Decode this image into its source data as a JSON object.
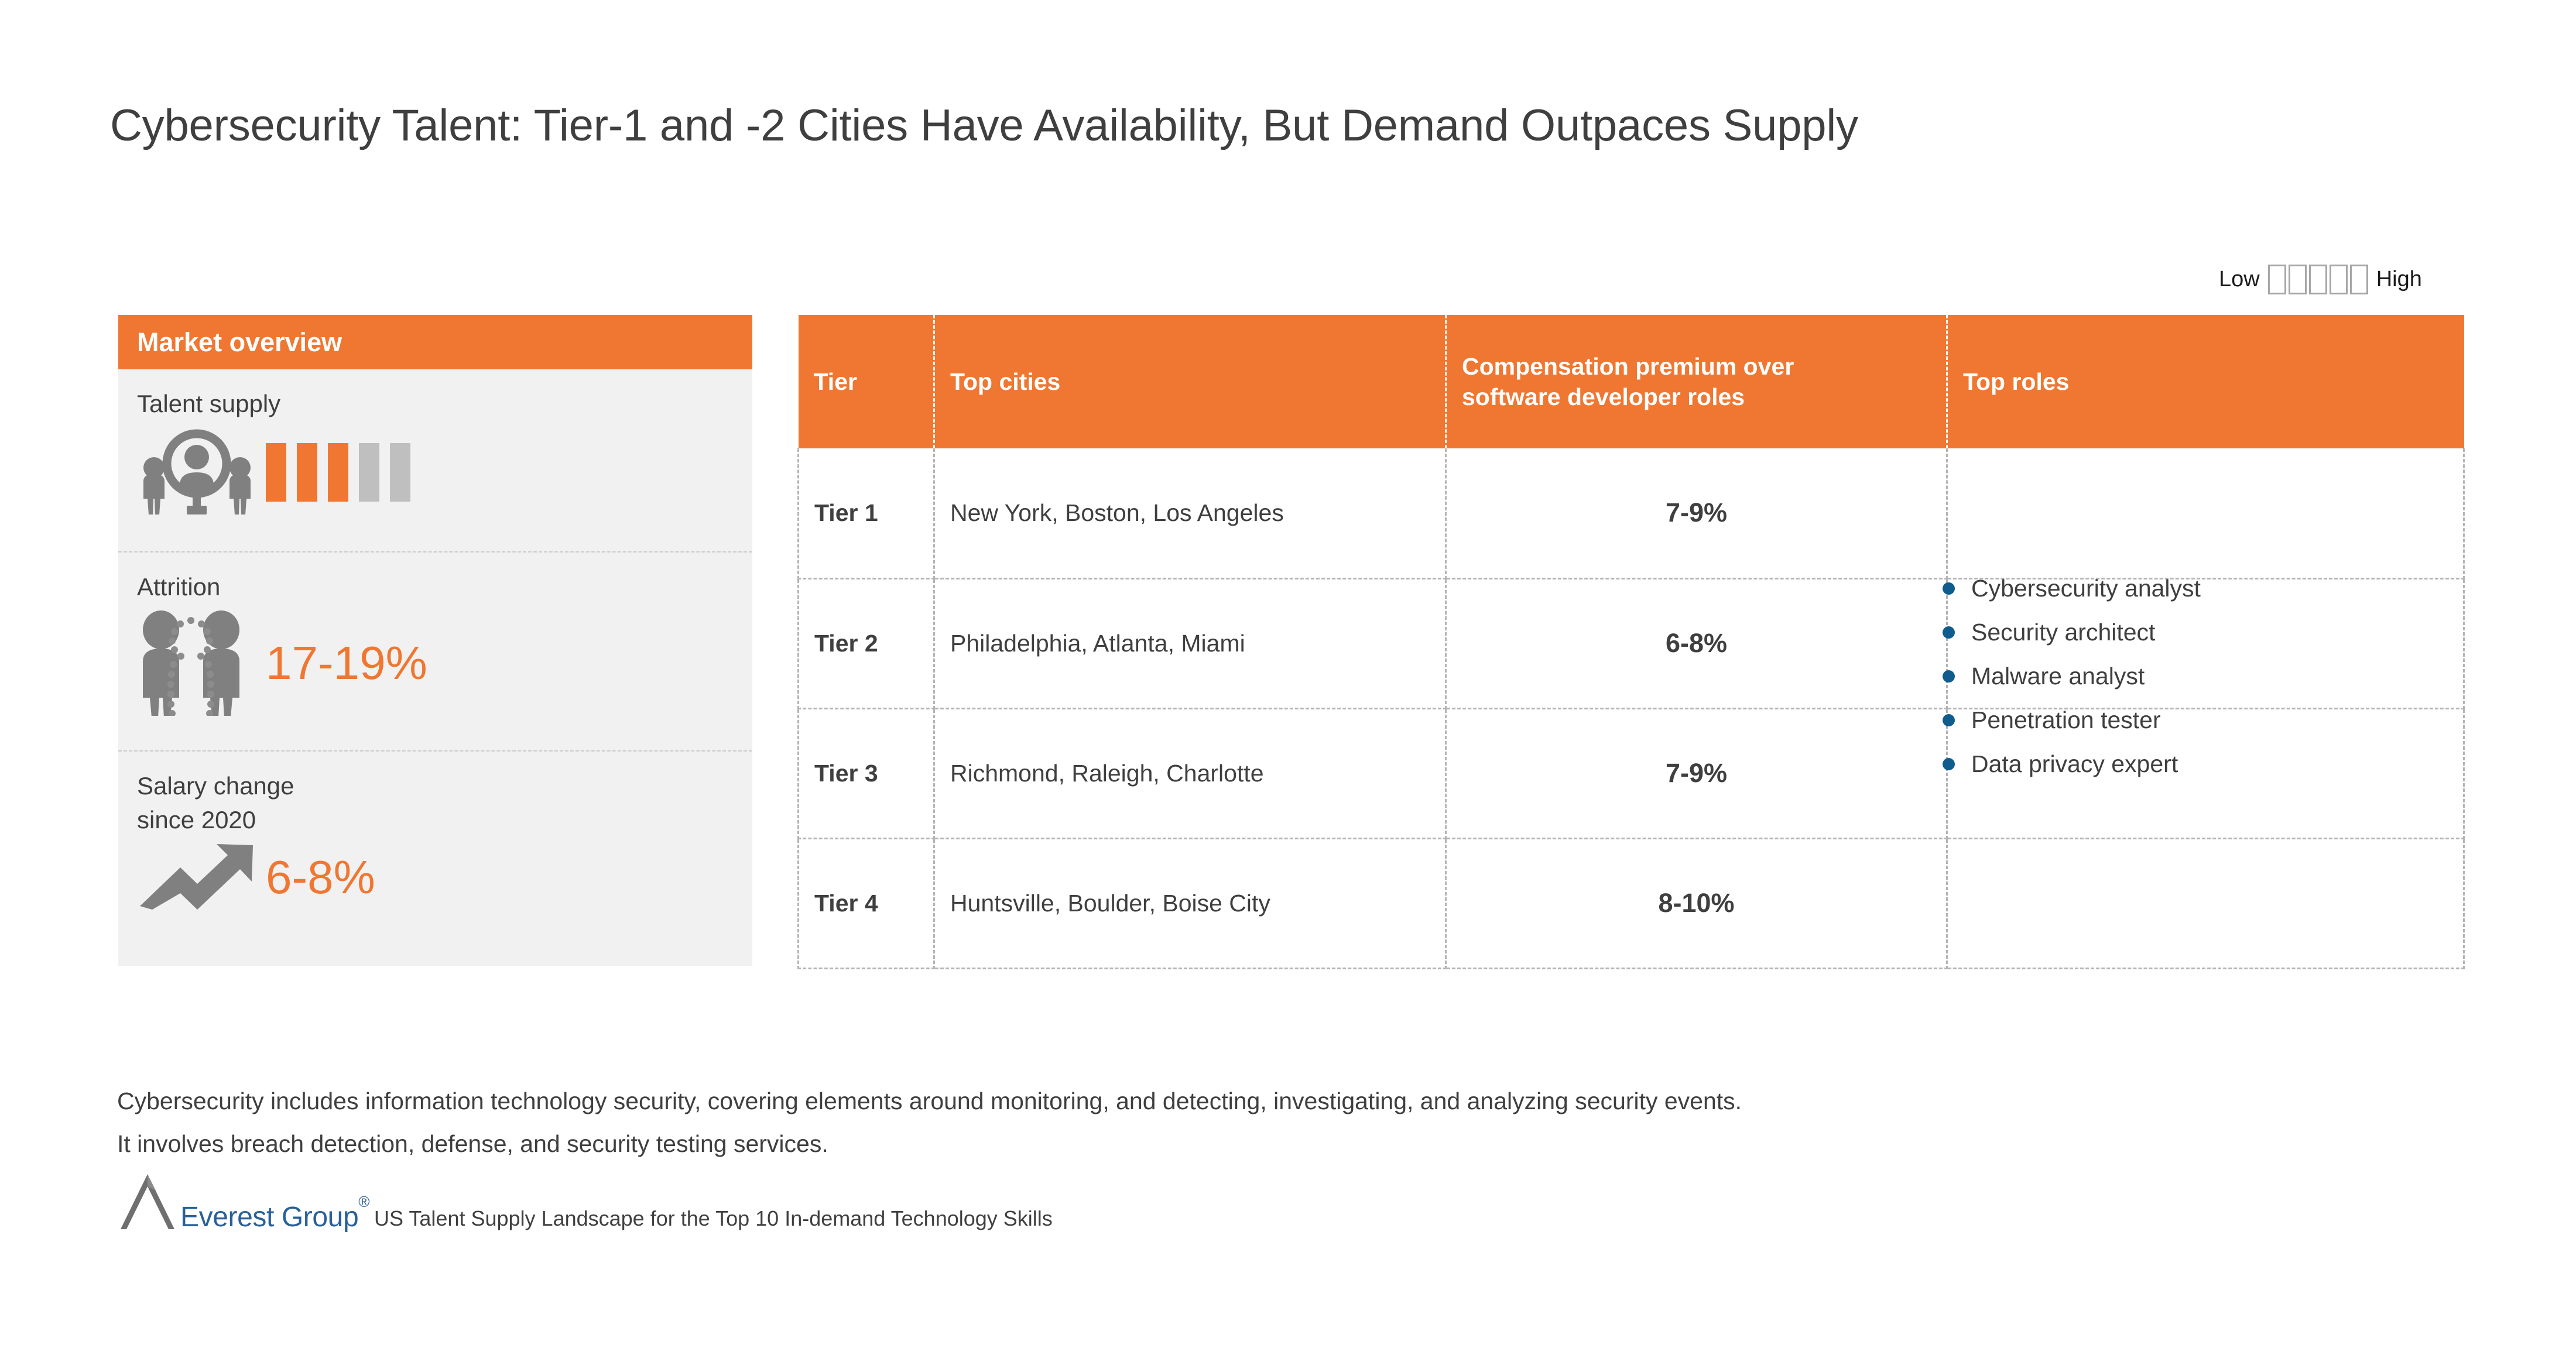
{
  "page": {
    "title": "Cybersecurity Talent: Tier-1 and -2 Cities Have Availability, But Demand Outpaces Supply"
  },
  "legend": {
    "low_label": "Low",
    "high_label": "High",
    "box_count": 5
  },
  "market_overview": {
    "header": "Market overview",
    "talent_supply": {
      "label": "Talent supply",
      "filled_bars": 3,
      "total_bars": 5,
      "icon": "people-magnifier-icon"
    },
    "attrition": {
      "label": "Attrition",
      "value": "17-19%",
      "icon": "attrition-people-icon"
    },
    "salary_change": {
      "label": "Salary change\nsince 2020",
      "label_line1": "Salary change",
      "label_line2": "since 2020",
      "value": "6-8%",
      "icon": "trend-up-arrow-icon"
    }
  },
  "table": {
    "headers": {
      "tier": "Tier",
      "top_cities": "Top cities",
      "compensation": "Compensation premium over software developer roles",
      "compensation_line1": "Compensation premium over",
      "compensation_line2": "software developer roles",
      "top_roles": "Top roles"
    },
    "rows": [
      {
        "tier": "Tier 1",
        "cities": "New York, Boston, Los Angeles",
        "premium": "7-9%"
      },
      {
        "tier": "Tier 2",
        "cities": "Philadelphia, Atlanta, Miami",
        "premium": "6-8%"
      },
      {
        "tier": "Tier 3",
        "cities": "Richmond, Raleigh, Charlotte",
        "premium": "7-9%"
      },
      {
        "tier": "Tier 4",
        "cities": "Huntsville, Boulder, Boise City",
        "premium": "8-10%"
      }
    ],
    "top_roles": [
      "Cybersecurity analyst",
      "Security architect",
      "Malware analyst",
      "Penetration tester",
      "Data privacy expert"
    ]
  },
  "footnote": {
    "line1": "Cybersecurity includes information technology security, covering elements around monitoring, and detecting, investigating, and analyzing security events.",
    "line2": "It involves breach detection, defense, and security testing services."
  },
  "source": {
    "brand": "Everest Group",
    "registered_mark": "®",
    "text": "US Talent Supply Landscape for the Top 10 In-demand Technology Skills"
  },
  "colors": {
    "accent_orange": "#F07731",
    "panel_gray": "#F1F1F1",
    "bar_gray": "#BFBFBF",
    "bullet_blue": "#0F5C8D",
    "text_dark": "#3F3F3F",
    "brand_blue": "#2A6099"
  }
}
